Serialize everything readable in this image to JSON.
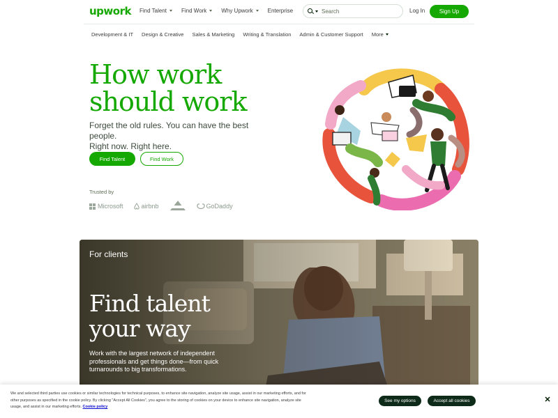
{
  "header": {
    "logo": "upwork",
    "nav": [
      {
        "label": "Find Talent",
        "dropdown": true
      },
      {
        "label": "Find Work",
        "dropdown": true
      },
      {
        "label": "Why Upwork",
        "dropdown": true
      },
      {
        "label": "Enterprise",
        "dropdown": false
      }
    ],
    "search_placeholder": "Search",
    "login": "Log In",
    "signup": "Sign Up"
  },
  "categories": [
    "Development & IT",
    "Design & Creative",
    "Sales & Marketing",
    "Writing & Translation",
    "Admin & Customer Support"
  ],
  "categories_more": "More",
  "hero": {
    "title_line1": "How work",
    "title_line2": "should work",
    "subtitle_line1": "Forget the old rules. You can have the best people.",
    "subtitle_line2": "Right now. Right here.",
    "find_talent": "Find Talent",
    "find_work": "Find Work",
    "trusted_by": "Trusted by",
    "brands": [
      "Microsoft",
      "airbnb",
      "bissell",
      "GoDaddy"
    ]
  },
  "clients_card": {
    "label": "For clients",
    "title_line1": "Find talent",
    "title_line2": "your way",
    "description": "Work with the largest network of independent professionals and get things done—from quick turnarounds to big transformations."
  },
  "cookie": {
    "text": "We and selected third parties use cookies or similar technologies for technical purposes, to enhance site navigation, analyze site usage, assist in our marketing efforts, and for other purposes as specified in the cookie policy. By clicking \"Accept All Cookies\", you agree to the storing of cookies on your device to enhance site navigation, analyze site usage, and assist in our marketing efforts.",
    "policy_link": "Cookie policy",
    "see_options": "See my options",
    "accept_all": "Accept all cookies",
    "close_symbol": "✕"
  },
  "colors": {
    "brand_green": "#14a800",
    "dark_green": "#0d2b18",
    "text": "#001e00"
  }
}
